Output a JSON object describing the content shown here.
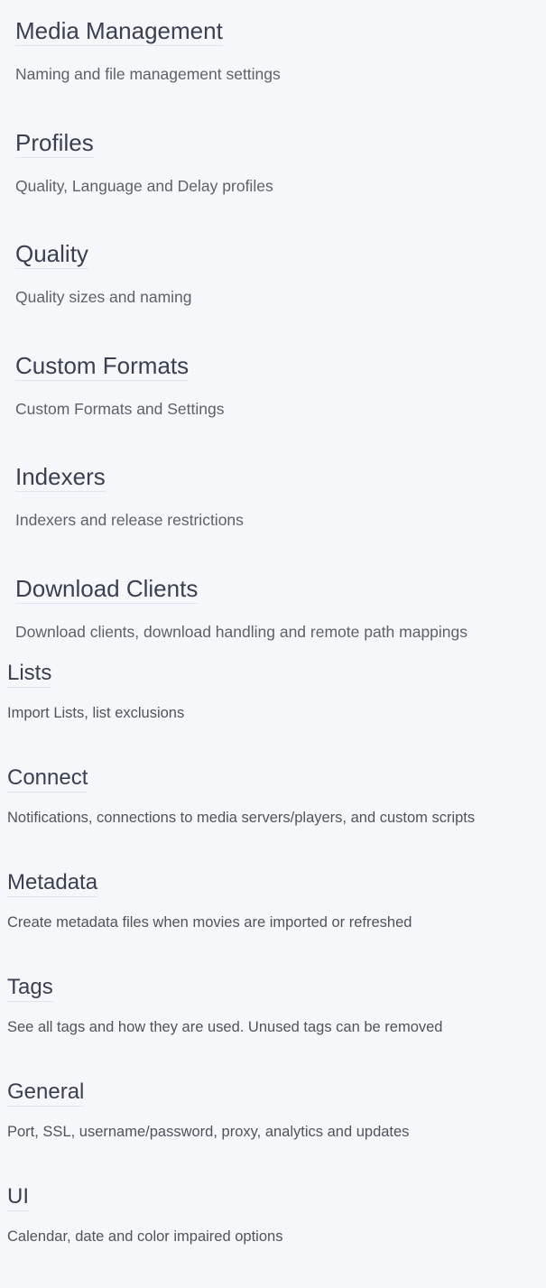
{
  "sections_primary": [
    {
      "title": "Media Management",
      "description": "Naming and file management settings"
    },
    {
      "title": "Profiles",
      "description": "Quality, Language and Delay profiles"
    },
    {
      "title": "Quality",
      "description": "Quality sizes and naming"
    },
    {
      "title": "Custom Formats",
      "description": "Custom Formats and Settings"
    },
    {
      "title": "Indexers",
      "description": "Indexers and release restrictions"
    },
    {
      "title": "Download Clients",
      "description": "Download clients, download handling and remote path mappings"
    }
  ],
  "sections_secondary": [
    {
      "title": "Lists",
      "description": "Import Lists, list exclusions"
    },
    {
      "title": "Connect",
      "description": "Notifications, connections to media servers/players, and custom scripts"
    },
    {
      "title": "Metadata",
      "description": "Create metadata files when movies are imported or refreshed"
    },
    {
      "title": "Tags",
      "description": "See all tags and how they are used. Unused tags can be removed"
    },
    {
      "title": "General",
      "description": "Port, SSL, username/password, proxy, analytics and updates"
    },
    {
      "title": "UI",
      "description": "Calendar, date and color impaired options"
    }
  ],
  "colors": {
    "background": "#f5f7fa",
    "heading": "#3a3f51",
    "description": "#5f6166"
  }
}
